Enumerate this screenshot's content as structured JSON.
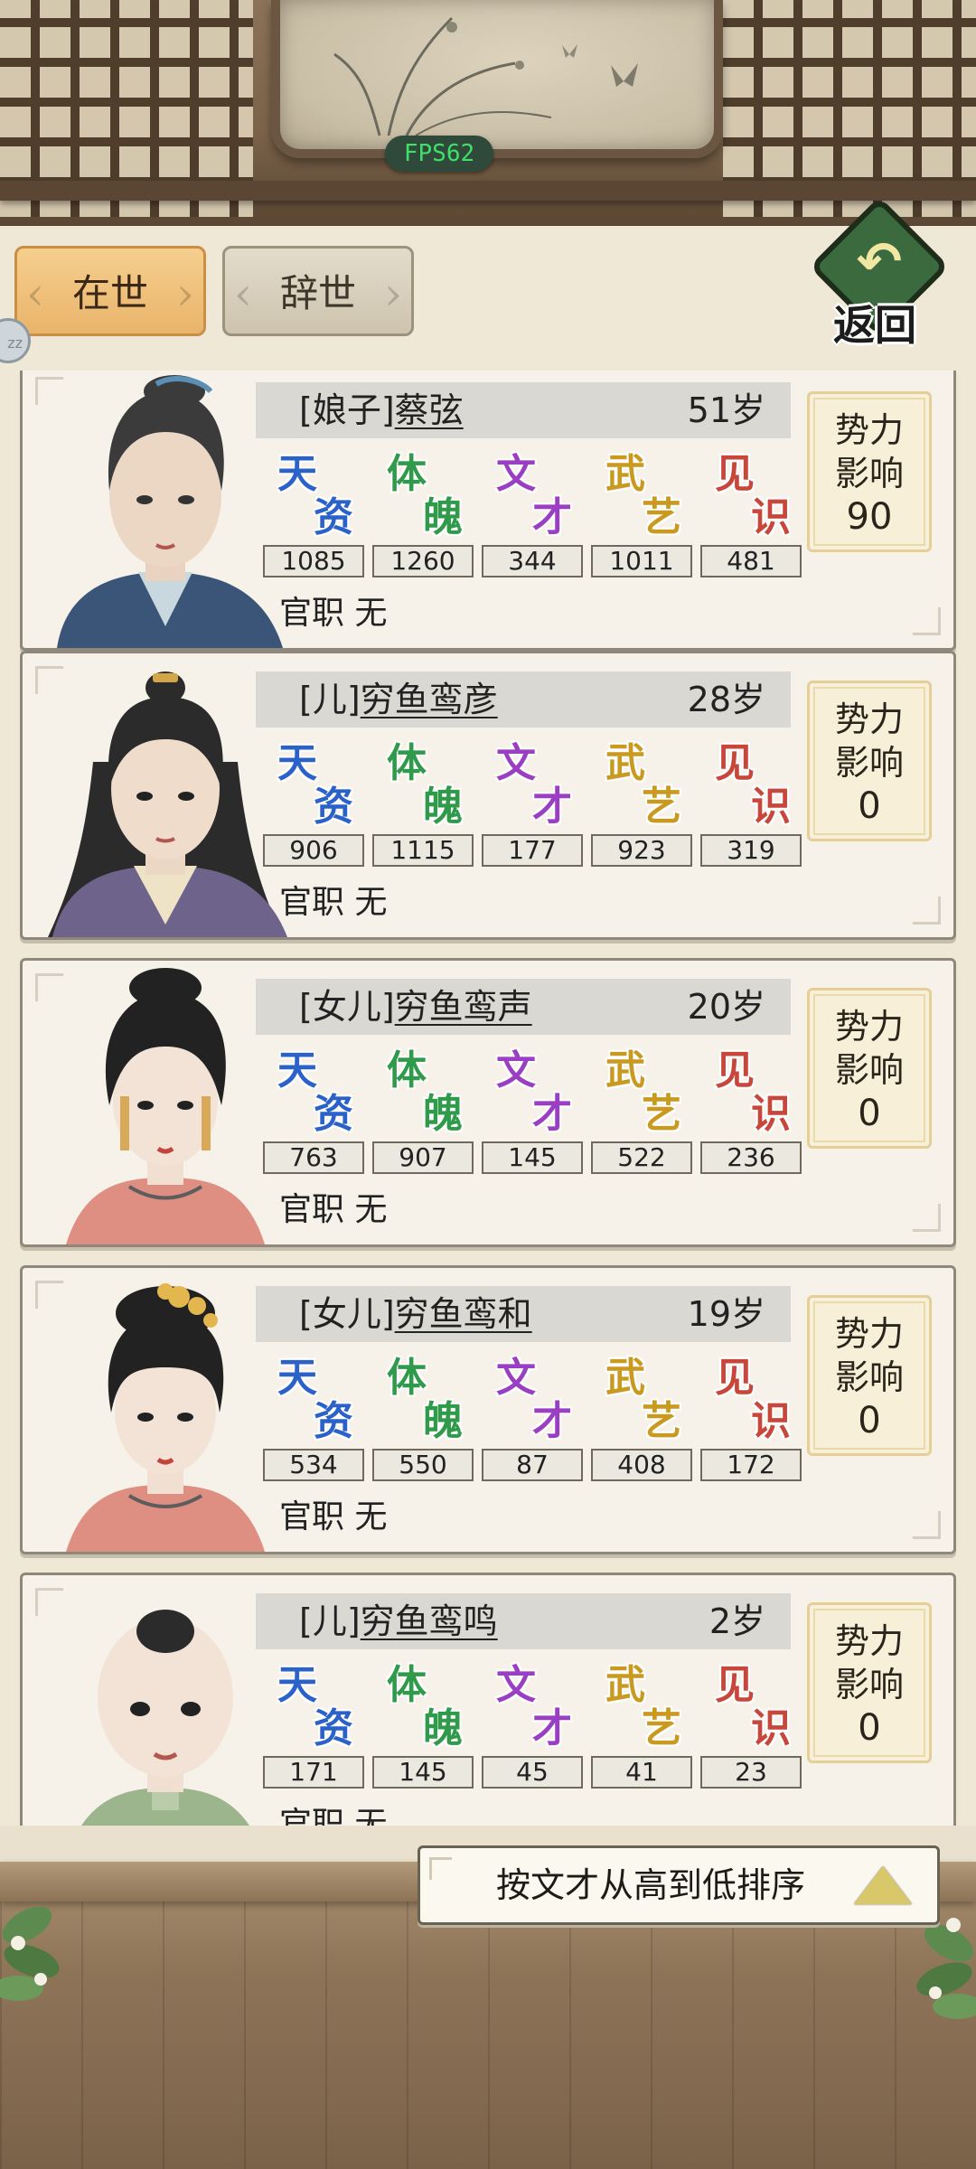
{
  "header": {
    "fps": "FPS62"
  },
  "tabs": [
    {
      "label": "在世",
      "active": true
    },
    {
      "label": "辞世",
      "active": false
    }
  ],
  "back": {
    "label": "返回"
  },
  "side_bubble": "zz",
  "stat_names": [
    {
      "c1": "天",
      "c2": "资",
      "color": "#2b62c9"
    },
    {
      "c1": "体",
      "c2": "魄",
      "color": "#2e9a4a"
    },
    {
      "c1": "文",
      "c2": "才",
      "color": "#9a3fc4"
    },
    {
      "c1": "武",
      "c2": "艺",
      "color": "#c99a1f"
    },
    {
      "c1": "见",
      "c2": "识",
      "color": "#c8463a"
    }
  ],
  "office_label": "官职",
  "influence_label": "势力影响",
  "members": [
    {
      "relation": "[娘子]",
      "name": "蔡弦",
      "age": "51岁",
      "stats": [
        "1085",
        "1260",
        "344",
        "1011",
        "481"
      ],
      "office": "无",
      "influence": "90",
      "portrait": "woman-elder"
    },
    {
      "relation": "[儿]",
      "name": "穷鱼鸾彦",
      "age": "28岁",
      "stats": [
        "906",
        "1115",
        "177",
        "923",
        "319"
      ],
      "office": "无",
      "influence": "0",
      "portrait": "young-man"
    },
    {
      "relation": "[女儿]",
      "name": "穷鱼鸾声",
      "age": "20岁",
      "stats": [
        "763",
        "907",
        "145",
        "522",
        "236"
      ],
      "office": "无",
      "influence": "0",
      "portrait": "young-woman"
    },
    {
      "relation": "[女儿]",
      "name": "穷鱼鸾和",
      "age": "19岁",
      "stats": [
        "534",
        "550",
        "87",
        "408",
        "172"
      ],
      "office": "无",
      "influence": "0",
      "portrait": "young-woman-flowers"
    },
    {
      "relation": "[儿]",
      "name": "穷鱼鸾鸣",
      "age": "2岁",
      "stats": [
        "171",
        "145",
        "45",
        "41",
        "23"
      ],
      "office": "无",
      "influence": "0",
      "portrait": "child"
    }
  ],
  "sort": {
    "label": "按文才从高到低排序"
  },
  "colors": {
    "tab_active": "#f0c07c",
    "tab_inactive": "#d8d0bf",
    "card_bg": "#f6f2e9",
    "influence_bg": "#f8efd9",
    "fps_text": "#3ee06a"
  }
}
